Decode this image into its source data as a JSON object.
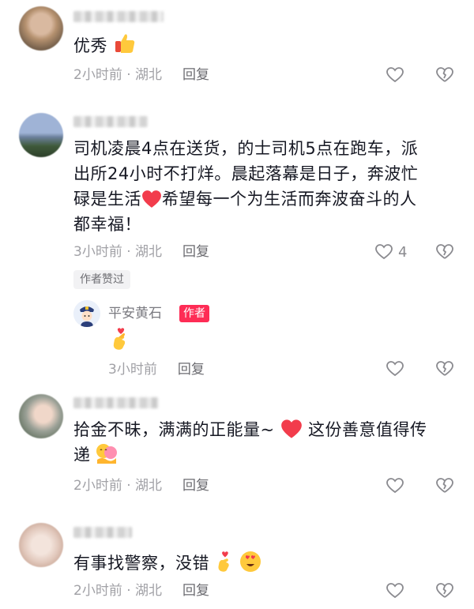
{
  "comments": [
    {
      "text": "优秀",
      "emoji": "thumbs-up",
      "time": "2小时前 · 湖北",
      "reply": "回复"
    },
    {
      "text": "司机凌晨4点在送货，的士司机5点在跑车，派出所24小时不打烊。晨起落幕是日子，奔波忙碌是生活❤️希望每一个为生活而奔波奋斗的人都幸福！",
      "line1": "司机凌晨4点在送货，的士司机5点在跑车，派",
      "line2": "出所24小时不打烊。晨起落幕是日子，奔波忙",
      "line3a": "碌是生活",
      "line3b": "希望每一个为生活而奔波奋斗的人",
      "line4": "都幸福！",
      "time": "3小时前 · 湖北",
      "reply": "回复",
      "like_count": "4",
      "author_liked": "作者赞过",
      "author_reply": {
        "name": "平安黄石",
        "tag": "作者",
        "emoji": "finger-heart",
        "time": "3小时前",
        "reply": "回复"
      }
    },
    {
      "line1a": "拾金不昧，满满的正能量~",
      "line1b": "这份善意值得传",
      "line2": "递",
      "time": "2小时前 · 湖北",
      "reply": "回复"
    },
    {
      "text": "有事找警察，没错",
      "time": "2小时前 · 湖北",
      "reply": "回复"
    }
  ],
  "colors": {
    "text": "#161823",
    "meta": "#a1a1a6",
    "author_tag": "#fe2c55",
    "heart": "#f23c4c"
  }
}
